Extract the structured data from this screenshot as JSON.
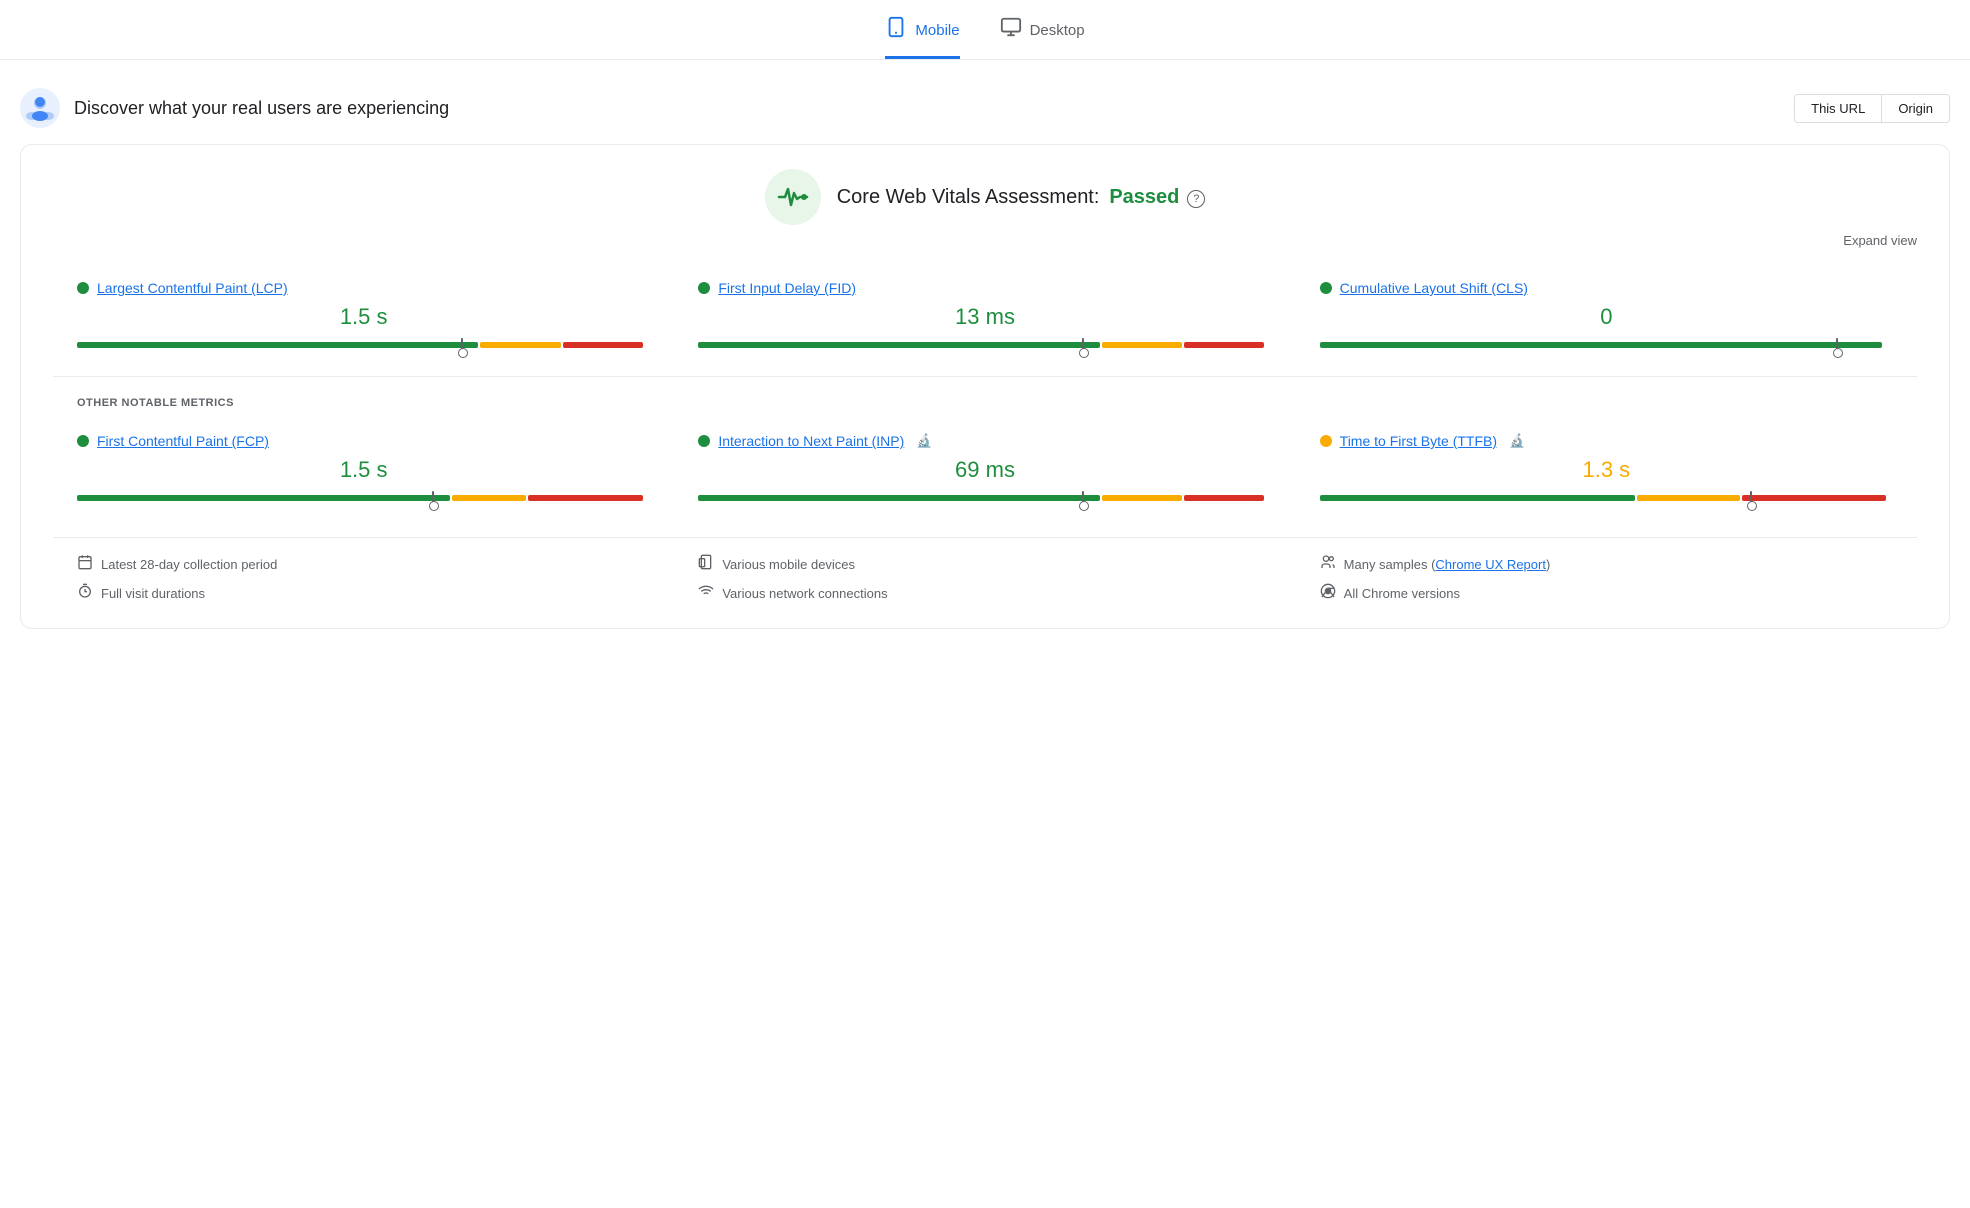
{
  "tabs": [
    {
      "id": "mobile",
      "label": "Mobile",
      "active": true,
      "icon": "📱"
    },
    {
      "id": "desktop",
      "label": "Desktop",
      "active": false,
      "icon": "🖥"
    }
  ],
  "discover": {
    "title": "Discover what your real users are experiencing",
    "buttons": [
      "This URL",
      "Origin"
    ],
    "active_button": "This URL"
  },
  "cwv": {
    "assessment_label": "Core Web Vitals Assessment:",
    "status": "Passed",
    "expand_label": "Expand view"
  },
  "core_metrics": [
    {
      "id": "lcp",
      "label": "Largest Contentful Paint (LCP)",
      "value": "1.5 s",
      "status": "green",
      "bar": {
        "green": 70,
        "orange": 15,
        "red": 15,
        "marker_pct": 67
      }
    },
    {
      "id": "fid",
      "label": "First Input Delay (FID)",
      "value": "13 ms",
      "status": "green",
      "bar": {
        "green": 70,
        "orange": 15,
        "red": 15,
        "marker_pct": 67
      }
    },
    {
      "id": "cls",
      "label": "Cumulative Layout Shift (CLS)",
      "value": "0",
      "status": "green",
      "bar": {
        "green": 100,
        "orange": 0,
        "red": 0,
        "marker_pct": 90
      }
    }
  ],
  "other_metrics_label": "OTHER NOTABLE METRICS",
  "other_metrics": [
    {
      "id": "fcp",
      "label": "First Contentful Paint (FCP)",
      "value": "1.5 s",
      "status": "green",
      "bar": {
        "green": 65,
        "orange": 15,
        "red": 20,
        "marker_pct": 62
      },
      "has_experiment": false
    },
    {
      "id": "inp",
      "label": "Interaction to Next Paint (INP)",
      "value": "69 ms",
      "status": "green",
      "bar": {
        "green": 70,
        "orange": 15,
        "red": 15,
        "marker_pct": 67
      },
      "has_experiment": true
    },
    {
      "id": "ttfb",
      "label": "Time to First Byte (TTFB)",
      "value": "1.3 s",
      "value_status": "orange",
      "status": "orange",
      "bar": {
        "green": 55,
        "orange": 20,
        "red": 25,
        "marker_pct": 75
      },
      "has_experiment": true
    }
  ],
  "footer": {
    "col1": [
      {
        "icon": "📅",
        "text": "Latest 28-day collection period"
      },
      {
        "icon": "⏱",
        "text": "Full visit durations"
      }
    ],
    "col2": [
      {
        "icon": "📱",
        "text": "Various mobile devices"
      },
      {
        "icon": "📶",
        "text": "Various network connections"
      }
    ],
    "col3": [
      {
        "icon": "👥",
        "text": "Many samples",
        "link": "Chrome UX Report",
        "after": ""
      },
      {
        "icon": "🌐",
        "text": "All Chrome versions"
      }
    ]
  }
}
